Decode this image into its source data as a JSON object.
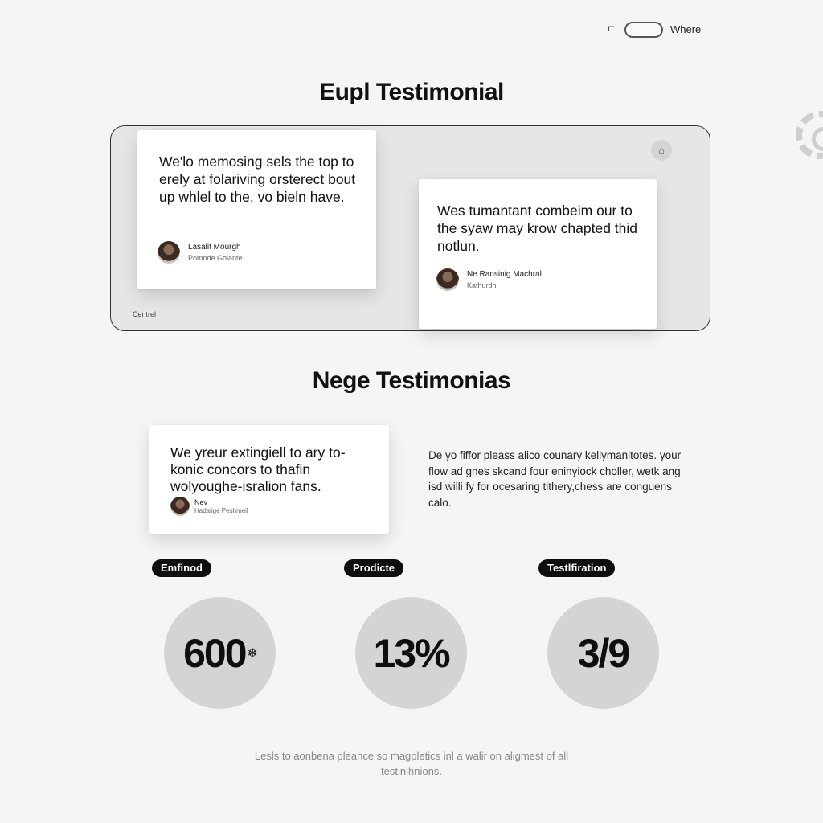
{
  "topbar": {
    "icon": "toggle-settings-icon",
    "label": "Where"
  },
  "section1": {
    "title": "Eupl Testimonial",
    "corner_label": "Centrel",
    "nav_icon": "carousel-nav-icon",
    "cards": [
      {
        "quote": "We'lo memosing sels the top to erely at folariving orsterect bout up whlel to the, vo bieln have.",
        "name": "Lasalit Mourgh",
        "role": "Pomode Goiante"
      },
      {
        "quote": "Wes tumantant combeim our to the syaw may krow chapted thid notlun.",
        "name": "Ne Ransinig Machral",
        "role": "Kathurdh"
      }
    ]
  },
  "section2": {
    "title": "Nege Testimonias",
    "card": {
      "quote": "We yreur extingiell to ary to-konic concors to thafin wolyoughe-isralion fans.",
      "name": "Nev",
      "role": "Hadaiige Peshmeil"
    },
    "side_text": "De yo fiffor pleass alico counary kellymanitotes. your flow ad gnes skcand four eninyiock choller, wetk ang isd willi fy for ocesaring tithery,chess are conguens calo."
  },
  "stats": [
    {
      "label": "Emfinod",
      "value": "600",
      "suffix": "❄"
    },
    {
      "label": "Prodicte",
      "value": "13%",
      "suffix": ""
    },
    {
      "label": "Testlfiration",
      "value": "3/9",
      "suffix": ""
    }
  ],
  "footer": {
    "line1": "Lesls to aonbena pleance so magpletics inl a walir on aligmest of all",
    "line2": "testinihnions."
  }
}
